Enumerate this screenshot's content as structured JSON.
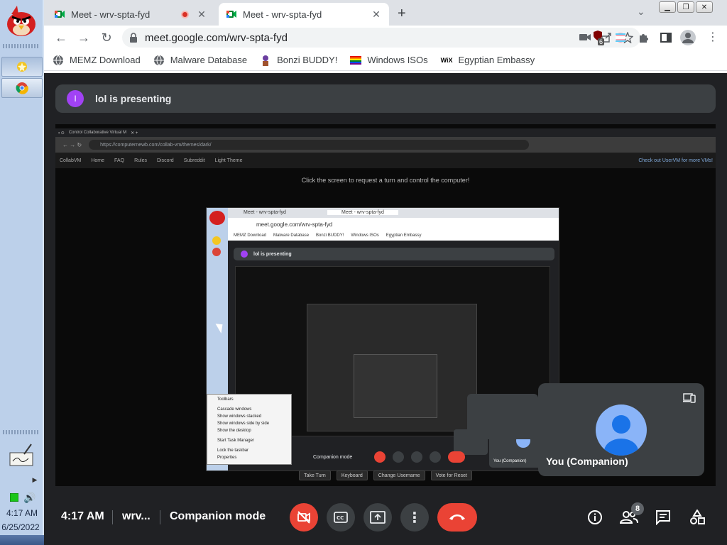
{
  "taskbar": {
    "clock_time": "4:17 AM",
    "clock_date": "6/25/2022"
  },
  "browser": {
    "tabs": [
      {
        "title": "Meet - wrv-spta-fyd",
        "recording": true
      },
      {
        "title": "Meet - wrv-spta-fyd",
        "recording": false
      }
    ],
    "url": "meet.google.com/wrv-spta-fyd",
    "extension_badge": "6",
    "bookmarks": [
      {
        "label": "MEMZ Download",
        "icon": "globe-icon"
      },
      {
        "label": "Malware Database",
        "icon": "globe-icon"
      },
      {
        "label": "Bonzi BUDDY!",
        "icon": "bonzi-icon"
      },
      {
        "label": "Windows ISOs",
        "icon": "rainbow-flag-icon"
      },
      {
        "label": "Egyptian Embassy",
        "icon": "wix-icon"
      }
    ],
    "wix_text": "WiX"
  },
  "meet": {
    "presenter_initial": "I",
    "presenting_text": "lol is presenting",
    "shared_screen": {
      "tab_title": "Control Collaborative Virtual M",
      "url": "https://computernewb.com/collab-vm/themes/dark/",
      "nav_items": [
        "CollabVM",
        "Home",
        "FAQ",
        "Rules",
        "Discord",
        "Subreddit",
        "Light Theme"
      ],
      "nav_right": "Check out UserVM for more VMs!",
      "prompt": "Click the screen to request a turn and control the computer!",
      "buttons": [
        "Take Turn",
        "Keyboard",
        "Change Username",
        "Vote for Reset"
      ],
      "vm": {
        "tab_title": "Meet - wrv-spta-fyd",
        "url": "meet.google.com/wrv-spta-fyd",
        "bookmarks": [
          "MEMZ Download",
          "Malware Database",
          "Bonzi BUDDY!",
          "Windows ISOs",
          "Egyptian Embassy"
        ],
        "presenting_text": "lol is presenting",
        "mode": "Companion mode",
        "tile_name": "You (Companion)",
        "context_menu": [
          "Toolbars",
          "Cascade windows",
          "Show windows stacked",
          "Show windows side by side",
          "Show the desktop",
          "Start Task Manager",
          "Lock the taskbar",
          "Properties"
        ]
      }
    },
    "self_tile": {
      "name": "You (Companion)"
    },
    "bottom": {
      "time": "4:17 AM",
      "meeting_code": "wrv...",
      "mode": "Companion mode",
      "participants_count": "8"
    }
  },
  "colors": {
    "meet_bg": "#202124",
    "tile_bg": "#3c4043",
    "red": "#ea4335",
    "avatar_blue": "#8ab4f8",
    "presenter_purple": "#a142f4"
  }
}
